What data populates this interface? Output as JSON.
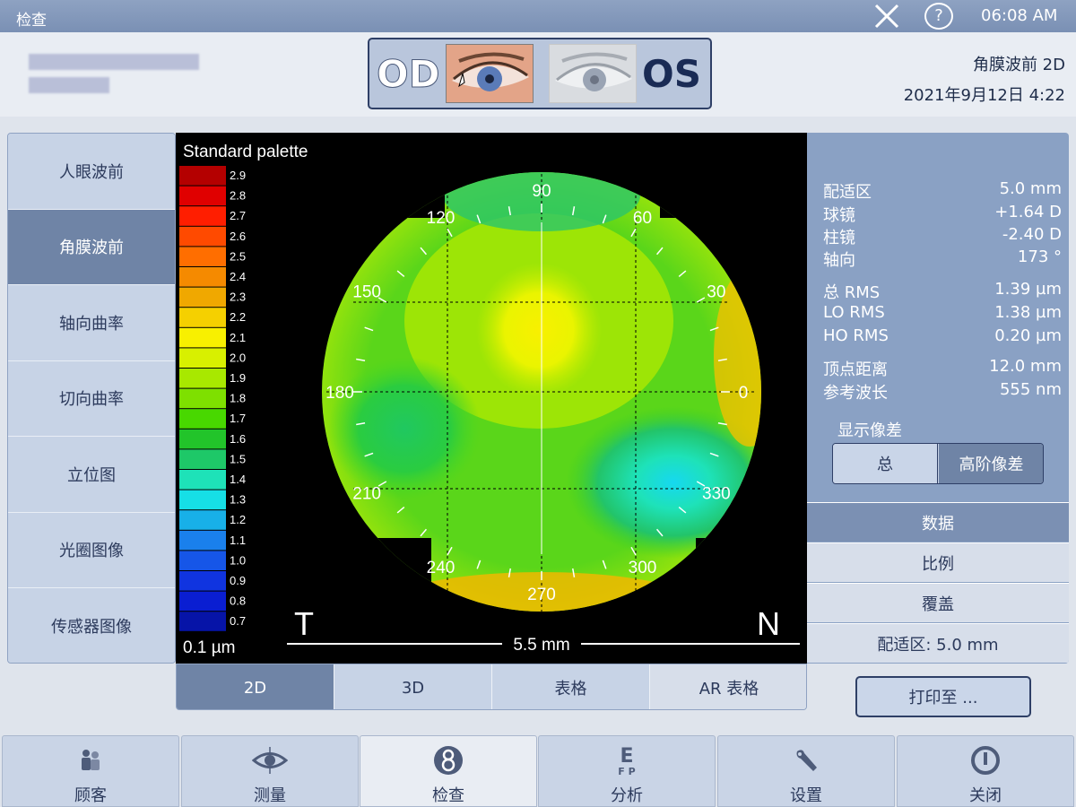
{
  "window": {
    "title": "检查",
    "clock": "06:08 AM"
  },
  "header": {
    "eye_od": "OD",
    "eye_os": "OS",
    "mode": "角膜波前 2D",
    "date": "2021年9月12日 4:22"
  },
  "nav": {
    "items": [
      {
        "label": "人眼波前",
        "active": false
      },
      {
        "label": "角膜波前",
        "active": true
      },
      {
        "label": "轴向曲率",
        "active": false
      },
      {
        "label": "切向曲率",
        "active": false
      },
      {
        "label": "立位图",
        "active": false
      },
      {
        "label": "光圈图像",
        "active": false
      },
      {
        "label": "传感器图像",
        "active": false
      }
    ]
  },
  "map": {
    "palette_title": "Standard palette",
    "palette_values": [
      "2.9",
      "2.8",
      "2.7",
      "2.6",
      "2.5",
      "2.4",
      "2.3",
      "2.2",
      "2.1",
      "2.0",
      "1.9",
      "1.8",
      "1.7",
      "1.6",
      "1.5",
      "1.4",
      "1.3",
      "1.2",
      "1.1",
      "1.0",
      "0.9",
      "0.8",
      "0.7"
    ],
    "palette_colors": [
      "#b40000",
      "#e00000",
      "#ff1e00",
      "#ff4a00",
      "#ff6e00",
      "#f58a00",
      "#f0a800",
      "#f5d000",
      "#f8f000",
      "#d8f000",
      "#a8e800",
      "#7ee000",
      "#48d800",
      "#22c42a",
      "#1ec868",
      "#1ee2b8",
      "#16dfe6",
      "#18b0e8",
      "#1a80ec",
      "#1656e8",
      "#1034e0",
      "#0a1ed2",
      "#0614a8"
    ],
    "step": "0.1 µm",
    "scale": "5.5 mm",
    "left_marker": "T",
    "right_marker": "N",
    "angles": [
      "0",
      "30",
      "60",
      "90",
      "120",
      "150",
      "180",
      "210",
      "240",
      "270",
      "300",
      "330"
    ]
  },
  "results": {
    "rows": [
      {
        "label": "配适区",
        "value": "5.0 mm"
      },
      {
        "label": "球镜",
        "value": "+1.64 D"
      },
      {
        "label": "柱镜",
        "value": "-2.40 D"
      },
      {
        "label": "轴向",
        "value": "173 °"
      },
      {
        "label": "总 RMS",
        "value": "1.39 µm"
      },
      {
        "label": "LO RMS",
        "value": "1.38 µm"
      },
      {
        "label": "HO RMS",
        "value": "0.20 µm"
      },
      {
        "label": "顶点距离",
        "value": "12.0 mm"
      },
      {
        "label": "参考波长",
        "value": "555 nm"
      }
    ],
    "display_title": "显示像差",
    "seg_total": "总",
    "seg_ho": "高阶像差",
    "tab_data": "数据",
    "tab_scale": "比例",
    "tab_overlay": "覆盖",
    "tab_zone": "配适区: 5.0 mm"
  },
  "viewtabs": [
    "2D",
    "3D",
    "表格",
    "AR 表格"
  ],
  "print_label": "打印至 ...",
  "bottom": [
    {
      "label": "顾客",
      "icon": "customer-icon"
    },
    {
      "label": "测量",
      "icon": "eye-measure-icon"
    },
    {
      "label": "检查",
      "icon": "exam-icon"
    },
    {
      "label": "分析",
      "icon": "eye-chart-icon"
    },
    {
      "label": "设置",
      "icon": "wrench-icon"
    },
    {
      "label": "关闭",
      "icon": "power-icon"
    }
  ]
}
